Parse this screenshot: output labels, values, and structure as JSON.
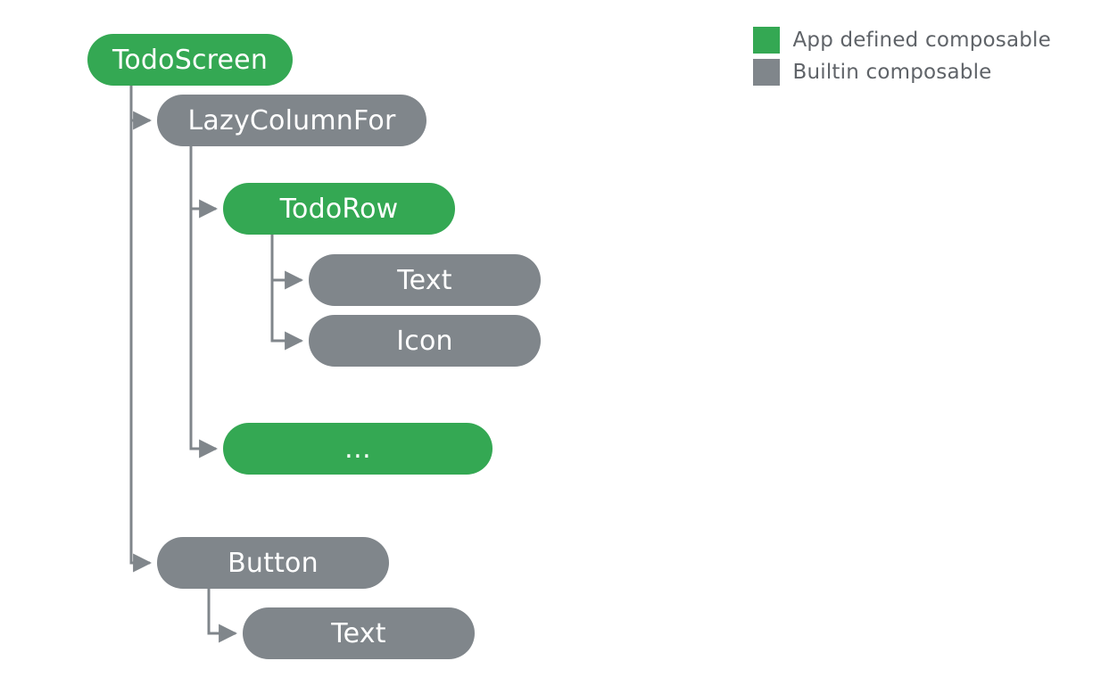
{
  "colors": {
    "app_defined": "#34a853",
    "builtin": "#80868b",
    "legend_text": "#5f6368",
    "background": "#ffffff"
  },
  "legend": {
    "app": "App defined composable",
    "builtin": "Builtin composable"
  },
  "nodes": {
    "todoScreen": {
      "label": "TodoScreen",
      "type": "app"
    },
    "lazyColumnFor": {
      "label": "LazyColumnFor",
      "type": "builtin"
    },
    "todoRow": {
      "label": "TodoRow",
      "type": "app"
    },
    "text1": {
      "label": "Text",
      "type": "builtin"
    },
    "icon": {
      "label": "Icon",
      "type": "builtin"
    },
    "ellipsis": {
      "label": "…",
      "type": "app"
    },
    "button": {
      "label": "Button",
      "type": "builtin"
    },
    "text2": {
      "label": "Text",
      "type": "builtin"
    }
  },
  "tree": {
    "TodoScreen": {
      "LazyColumnFor": {
        "TodoRow": [
          "Text",
          "Icon"
        ],
        "…": []
      },
      "Button": [
        "Text"
      ]
    }
  }
}
